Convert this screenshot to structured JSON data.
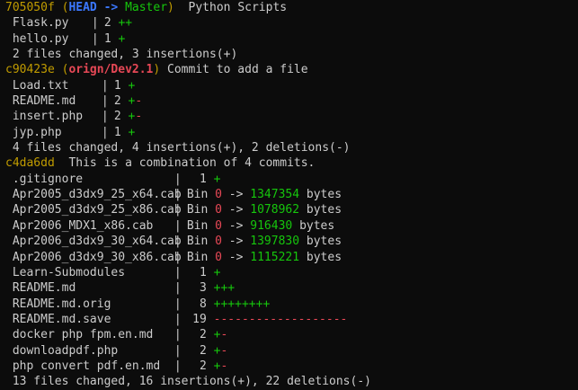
{
  "colors": {
    "background": "#0c0c0c",
    "default_text": "#cccccc",
    "commit_hash": "#c19c00",
    "head_ref": "#3b78ff",
    "branch_local": "#16c60c",
    "branch_remote": "#e74856",
    "insertions": "#16c60c",
    "deletions": "#e74856"
  },
  "commits": [
    {
      "hash": "705050f",
      "decoration": {
        "head": "HEAD",
        "arrow": "->",
        "branch": "Master"
      },
      "message": "Python Scripts",
      "files": [
        {
          "name": "Flask.py",
          "sep": "|",
          "count": "2",
          "plus": "++",
          "minus": ""
        },
        {
          "name": "hello.py",
          "sep": "|",
          "count": "1",
          "plus": "+",
          "minus": ""
        }
      ],
      "summary": "2 files changed, 3 insertions(+)"
    },
    {
      "hash": "c90423e",
      "decoration": {
        "branch": "orign/Dev2.1"
      },
      "message": "Commit to add a file",
      "files": [
        {
          "name": "Load.txt",
          "sep": "|",
          "count": "1",
          "plus": "+",
          "minus": ""
        },
        {
          "name": "README.md",
          "sep": "|",
          "count": "2",
          "plus": "+",
          "minus": "-"
        },
        {
          "name": "insert.php",
          "sep": "|",
          "count": "2",
          "plus": "+",
          "minus": "-"
        },
        {
          "name": "jyp.php",
          "sep": "|",
          "count": "1",
          "plus": "+",
          "minus": ""
        }
      ],
      "summary": "4 files changed, 4 insertions(+), 2 deletions(-)"
    },
    {
      "hash": "c4da6dd",
      "message": "This is a combination of 4 commits.",
      "files": [
        {
          "name": ".gitignore",
          "sep": "|",
          "count": "1",
          "plus": "+",
          "minus": ""
        },
        {
          "name": "Apr2005_d3dx9_25_x64.cab",
          "sep": "|",
          "bin": true,
          "bin_label": "Bin",
          "old": "0",
          "arrow": "->",
          "new": "1347354",
          "unit": "bytes"
        },
        {
          "name": "Apr2005_d3dx9_25_x86.cab",
          "sep": "|",
          "bin": true,
          "bin_label": "Bin",
          "old": "0",
          "arrow": "->",
          "new": "1078962",
          "unit": "bytes"
        },
        {
          "name": "Apr2006_MDX1_x86.cab",
          "sep": "|",
          "bin": true,
          "bin_label": "Bin",
          "old": "0",
          "arrow": "->",
          "new": "916430",
          "unit": "bytes"
        },
        {
          "name": "Apr2006_d3dx9_30_x64.cab",
          "sep": "|",
          "bin": true,
          "bin_label": "Bin",
          "old": "0",
          "arrow": "->",
          "new": "1397830",
          "unit": "bytes"
        },
        {
          "name": "Apr2006_d3dx9_30_x86.cab",
          "sep": "|",
          "bin": true,
          "bin_label": "Bin",
          "old": "0",
          "arrow": "->",
          "new": "1115221",
          "unit": "bytes"
        },
        {
          "name": "Learn-Submodules",
          "sep": "|",
          "count": "1",
          "plus": "+",
          "minus": ""
        },
        {
          "name": "README.md",
          "sep": "|",
          "count": "3",
          "plus": "+++",
          "minus": ""
        },
        {
          "name": "README.md.orig",
          "sep": "|",
          "count": "8",
          "plus": "++++++++",
          "minus": ""
        },
        {
          "name": "README.md.save",
          "sep": "|",
          "count": "19",
          "plus": "",
          "minus": "-------------------"
        },
        {
          "name": "docker php fpm.en.md",
          "sep": "|",
          "count": "2",
          "plus": "+",
          "minus": "-"
        },
        {
          "name": "downloadpdf.php",
          "sep": "|",
          "count": "2",
          "plus": "+",
          "minus": "-"
        },
        {
          "name": "php convert pdf.en.md",
          "sep": "|",
          "count": "2",
          "plus": "+",
          "minus": "-"
        }
      ],
      "summary": "13 files changed, 16 insertions(+), 22 deletions(-)"
    }
  ]
}
